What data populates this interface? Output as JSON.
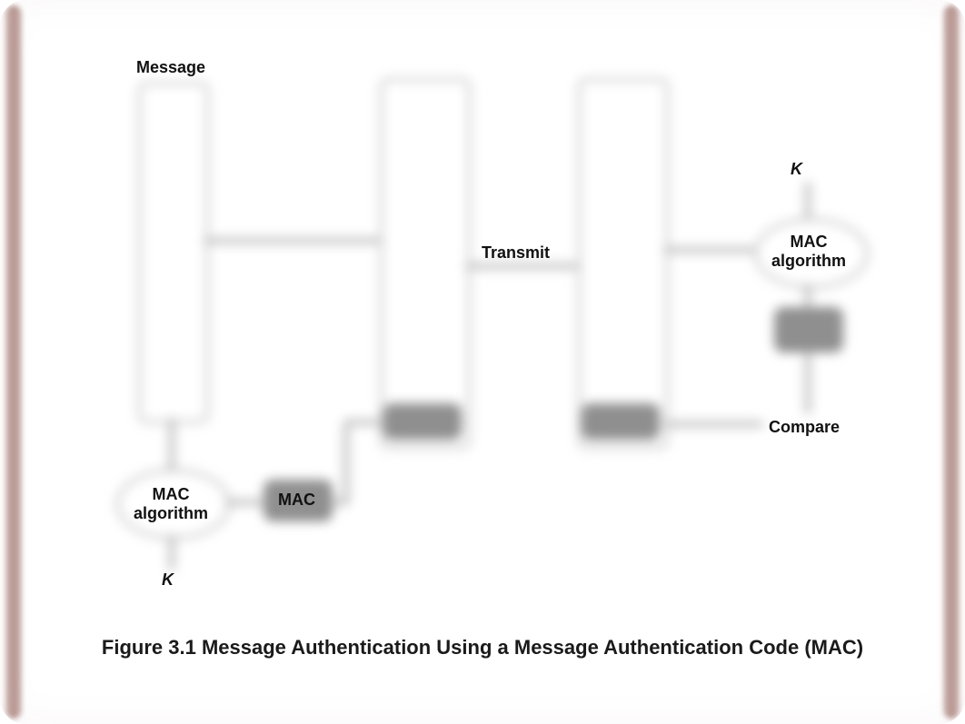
{
  "labels": {
    "message": "Message",
    "mac_algo": "MAC\nalgorithm",
    "k": "K",
    "mac": "MAC",
    "transmit": "Transmit",
    "compare": "Compare"
  },
  "caption": "Figure 3.1   Message Authentication Using a Message Authentication Code (MAC)"
}
